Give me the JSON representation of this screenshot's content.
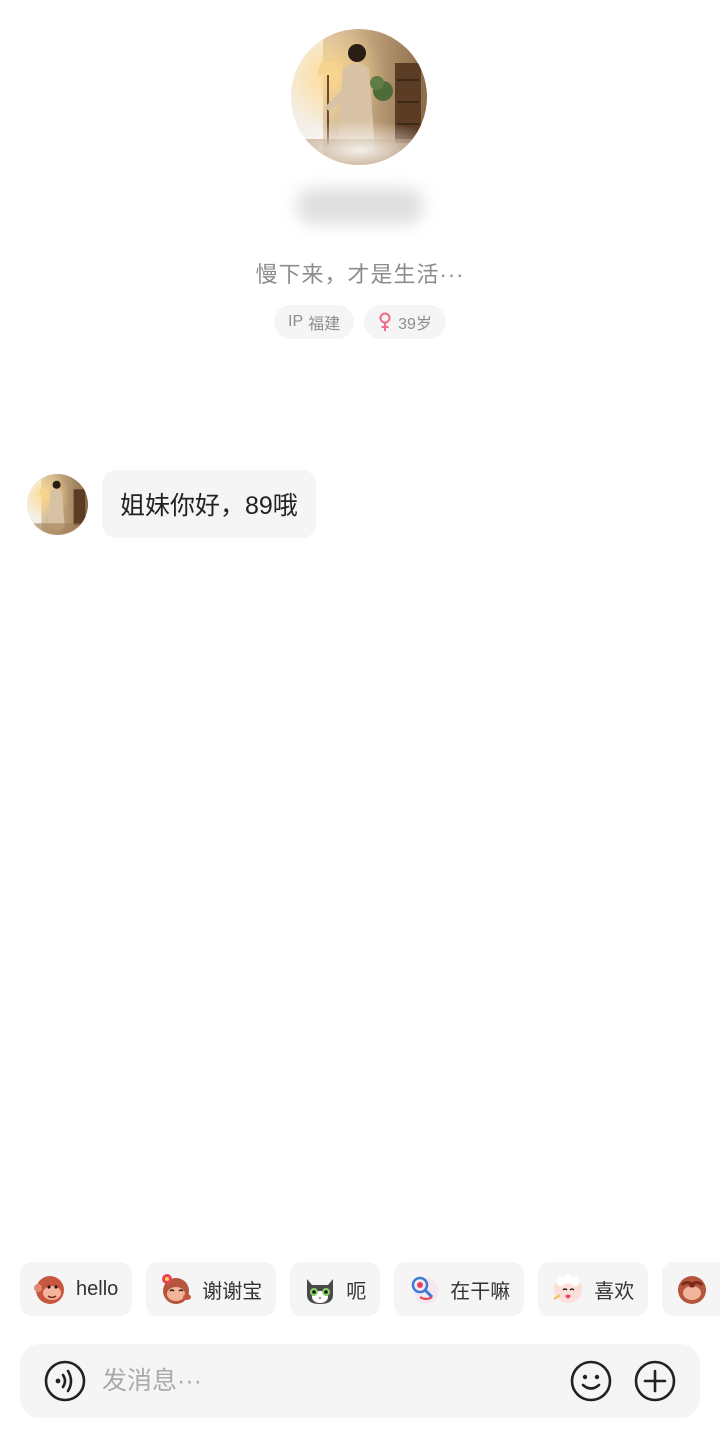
{
  "profile": {
    "name_hidden": "",
    "bio": "慢下来，才是生活···",
    "tags": {
      "ip_prefix": "IP",
      "ip_location": "福建",
      "age": "39岁",
      "gender_icon": "female-icon"
    }
  },
  "messages": [
    {
      "sender": "other",
      "text": "姐妹你好，89哦"
    }
  ],
  "quick_replies": [
    {
      "icon": "monkey-sticker",
      "label": "hello"
    },
    {
      "icon": "monkey-flower-sticker",
      "label": "谢谢宝"
    },
    {
      "icon": "cat-sticker",
      "label": "呃"
    },
    {
      "icon": "magnifier-sticker",
      "label": "在干嘛"
    },
    {
      "icon": "sheep-sticker",
      "label": "喜欢"
    },
    {
      "icon": "monkey-shy-sticker",
      "label": ""
    }
  ],
  "input_bar": {
    "placeholder": "发消息···",
    "voice_icon": "voice-icon",
    "emoji_icon": "smiley-icon",
    "plus_icon": "plus-icon"
  },
  "colors": {
    "accent_female": "#f06b8a",
    "bubble_bg": "#f5f5f5"
  }
}
